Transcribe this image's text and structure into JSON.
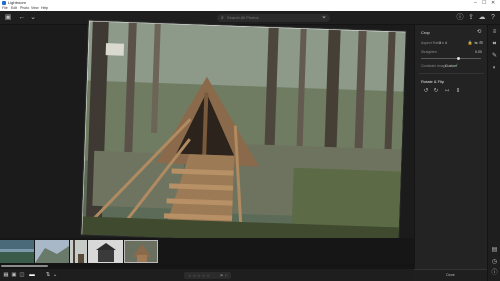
{
  "window": {
    "title": "Lightroom",
    "controls": [
      "–",
      "☐",
      "✕"
    ]
  },
  "menu": [
    "File",
    "Edit",
    "Photo",
    "View",
    "Help"
  ],
  "toolbar": {
    "search_placeholder": "Search All Photos"
  },
  "panel": {
    "crop_title": "Crop",
    "aspect_label": "Aspect Ratio",
    "aspect_value": "3 × 4",
    "straighten_label": "Straighten",
    "straighten_value": "0.00",
    "straighten_level": 0.62,
    "constrain_label": "Constrain Image",
    "constrain_value": "Custom",
    "rotate_title": "Rotate & Flip",
    "done_label": "Done"
  },
  "filmstrip": {
    "thumbs": [
      {
        "name": "lake-landscape"
      },
      {
        "name": "mountain-hills"
      },
      {
        "name": "trees-shelter"
      },
      {
        "name": "cabin-dark"
      },
      {
        "name": "a-frame-shelter"
      }
    ]
  },
  "bottombar": {
    "stars": "☆☆☆☆☆",
    "flags": "⚑ ⚐"
  },
  "colors": {
    "accent": "#1f6fd1",
    "panel": "#232323",
    "canvas": "#1b1b1b"
  }
}
